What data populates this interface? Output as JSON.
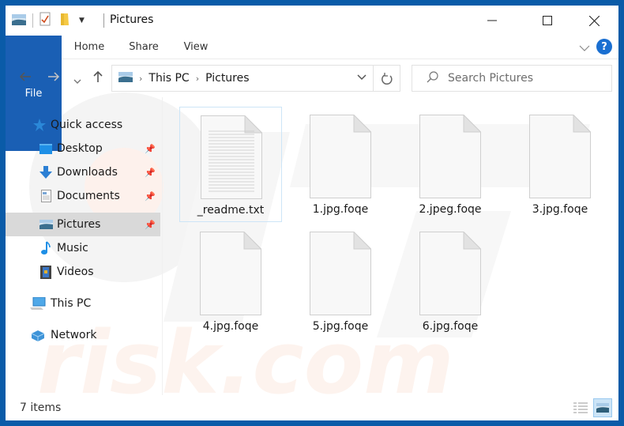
{
  "window": {
    "title": "Pictures",
    "controls": {
      "minimize": "minimize",
      "maximize": "maximize",
      "close": "close"
    }
  },
  "ribbon": {
    "tabs": [
      {
        "label": "File",
        "active": true
      },
      {
        "label": "Home"
      },
      {
        "label": "Share"
      },
      {
        "label": "View"
      }
    ],
    "help_label": "?"
  },
  "address": {
    "breadcrumbs": [
      "This PC",
      "Pictures"
    ],
    "search_placeholder": "Search Pictures"
  },
  "nav_pane": {
    "items": [
      {
        "label": "Quick access",
        "icon": "star-icon",
        "indent": 0
      },
      {
        "label": "Desktop",
        "icon": "desktop-icon",
        "indent": 1,
        "pinned": true
      },
      {
        "label": "Downloads",
        "icon": "download-arrow-icon",
        "indent": 1,
        "pinned": true
      },
      {
        "label": "Documents",
        "icon": "document-icon",
        "indent": 1,
        "pinned": true
      },
      {
        "label": "Pictures",
        "icon": "pictures-icon",
        "indent": 1,
        "pinned": true,
        "selected": true
      },
      {
        "label": "Music",
        "icon": "music-note-icon",
        "indent": 1
      },
      {
        "label": "Videos",
        "icon": "film-icon",
        "indent": 1
      },
      {
        "label": "This PC",
        "icon": "computer-icon",
        "indent": 0
      },
      {
        "label": "Network",
        "icon": "network-icon",
        "indent": 0
      }
    ]
  },
  "files": [
    {
      "name": "_readme.txt",
      "type": "text",
      "selected": true
    },
    {
      "name": "1.jpg.foqe",
      "type": "blank"
    },
    {
      "name": "2.jpeg.foqe",
      "type": "blank"
    },
    {
      "name": "3.jpg.foqe",
      "type": "blank"
    },
    {
      "name": "4.jpg.foqe",
      "type": "blank"
    },
    {
      "name": "5.jpg.foqe",
      "type": "blank"
    },
    {
      "name": "6.jpg.foqe",
      "type": "blank"
    }
  ],
  "status": {
    "item_count": "7 items",
    "view_modes": [
      "details",
      "large-icons"
    ],
    "active_view": "large-icons"
  },
  "colors": {
    "accent": "#1a5fb4",
    "frame": "#0a5ba8",
    "selection": "#d9d9d9"
  },
  "watermark": "PC risk.com"
}
